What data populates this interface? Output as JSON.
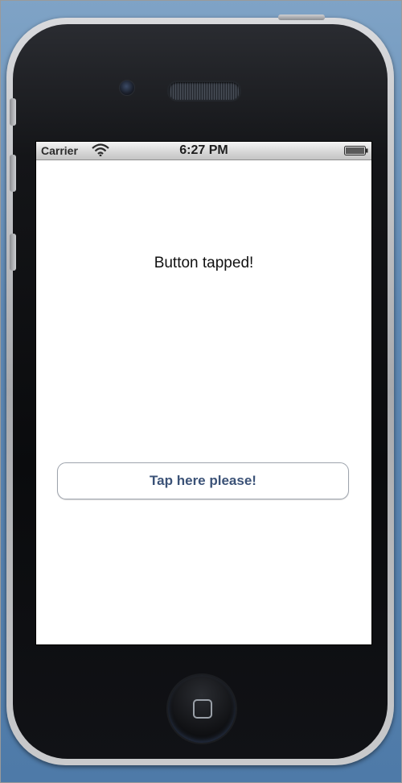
{
  "status_bar": {
    "carrier": "Carrier",
    "time": "6:27 PM",
    "wifi_icon": "wifi-icon",
    "battery_icon": "battery-icon"
  },
  "main": {
    "message": "Button tapped!",
    "button_label": "Tap here please!"
  },
  "colors": {
    "background": "#5f89b4",
    "button_text": "#3b5277",
    "button_border": "#9ea4ad",
    "screen_background": "#ffffff"
  }
}
